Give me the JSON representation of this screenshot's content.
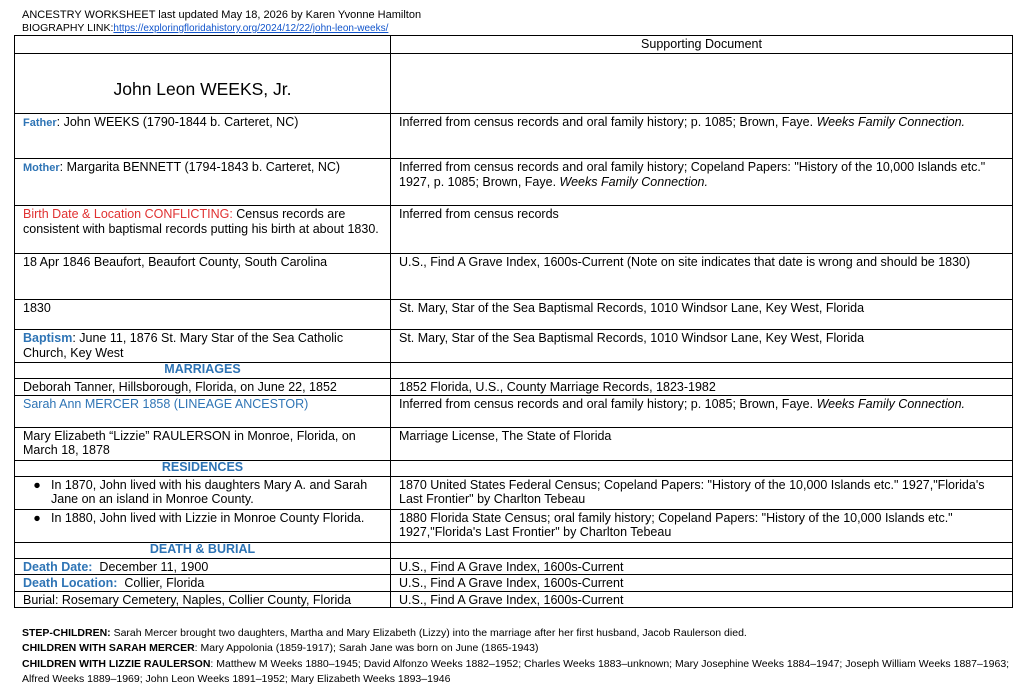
{
  "header": {
    "title_line": "ANCESTRY WORKSHEET last updated May 18, 2026 by Karen Yvonne Hamilton",
    "bio_label": "BIOGRAPHY LINK:",
    "bio_link": "https://exploringfloridahistory.org/2024/12/22/john-leon-weeks/"
  },
  "table": {
    "col_header": "Supporting Document",
    "name": "John Leon WEEKS, Jr.",
    "father_label": "Father",
    "father_value": ": John WEEKS (1790-1844 b. Carteret, NC)",
    "father_doc": "Inferred from census records and oral family history; p. 1085; Brown, Faye.",
    "father_doc_italic": "Weeks Family Connection.",
    "mother_label": "Mother",
    "mother_value": ": Margarita BENNETT (1794-1843 b. Carteret, NC)",
    "mother_doc": "Inferred from census records and oral family history; Copeland Papers: \"History of the 10,000 Islands etc.\" 1927, p. 1085; Brown, Faye.",
    "mother_doc_italic": "Weeks Family Connection.",
    "birth_label": "Birth Date & Location CONFLICTING:",
    "birth_value": " Census records are consistent with baptismal records putting his birth at about 1830.",
    "birth_doc": "Inferred from census records",
    "birth2_value": "18 Apr 1846 Beaufort, Beaufort County, South Carolina",
    "birth2_doc": "U.S., Find A Grave Index, 1600s-Current (Note on site indicates that date is wrong and should be 1830)",
    "birth3_value": "1830",
    "birth3_doc": "St. Mary, Star of the Sea Baptismal Records, 1010 Windsor Lane, Key West, Florida",
    "baptism_label": "Baptism",
    "baptism_value": ": June 11, 1876 St. Mary Star of the Sea Catholic Church, Key West",
    "baptism_doc": "St. Mary, Star of the Sea Baptismal Records, 1010 Windsor Lane, Key West, Florida",
    "marriages_header": "MARRIAGES",
    "marriage1": "Deborah Tanner, Hillsborough, Florida, on June 22, 1852",
    "marriage1_doc": "1852 Florida, U.S., County Marriage Records, 1823-1982",
    "marriage2": "Sarah Ann MERCER 1858 (LINEAGE ANCESTOR)",
    "marriage2_doc": "Inferred from census records and oral family history; p. 1085; Brown, Faye.",
    "marriage2_doc_italic": "Weeks Family Connection.",
    "marriage3": "Mary Elizabeth “Lizzie” RAULERSON in Monroe, Florida, on March 18, 1878",
    "marriage3_doc": "Marriage License, The State of Florida",
    "residences_header": "RESIDENCES",
    "res1": "In 1870, John lived with his daughters Mary A. and Sarah Jane on an island in Monroe County.",
    "res1_doc": "1870 United States Federal Census; Copeland Papers: \"History of the 10,000 Islands etc.\" 1927,\"Florida's Last Frontier\" by Charlton Tebeau",
    "res2": "In 1880, John lived with Lizzie in Monroe County Florida.",
    "res2_doc": "1880 Florida State Census; oral family history; Copeland Papers: \"History of the 10,000 Islands etc.\" 1927,\"Florida's Last Frontier\" by Charlton Tebeau",
    "bullet": "●",
    "death_header": "DEATH & BURIAL",
    "death_date_label": "Death Date:",
    "death_date_value": "  December 11, 1900",
    "death_date_doc": "U.S., Find A Grave Index, 1600s-Current",
    "death_loc_label": "Death Location:",
    "death_loc_value": "  Collier, Florida",
    "death_loc_doc": "U.S., Find A Grave Index, 1600s-Current",
    "burial": "Burial: Rosemary Cemetery, Naples, Collier County, Florida",
    "burial_doc": "U.S., Find A Grave Index, 1600s-Current"
  },
  "footer": {
    "step_label": "STEP-CHILDREN:",
    "step_text": " Sarah Mercer brought two daughters, Martha and Mary Elizabeth (Lizzy) into the marriage after her first husband, Jacob Raulerson died.",
    "sarah_label": "CHILDREN WITH SARAH MERCER",
    "sarah_text": ": Mary Appolonia (1859-1917); Sarah Jane was born on June (1865-1943)",
    "lizzie_label": "CHILDREN WITH LIZZIE RAULERSON",
    "lizzie_text": ": Matthew M Weeks 1880–1945; David Alfonzo Weeks 1882–1952; Charles Weeks 1883–unknown; Mary Josephine Weeks 1884–1947; Joseph William Weeks 1887–1963; Alfred Weeks 1889–1969; John Leon Weeks 1891–1952; Mary Elizabeth Weeks 1893–1946"
  }
}
